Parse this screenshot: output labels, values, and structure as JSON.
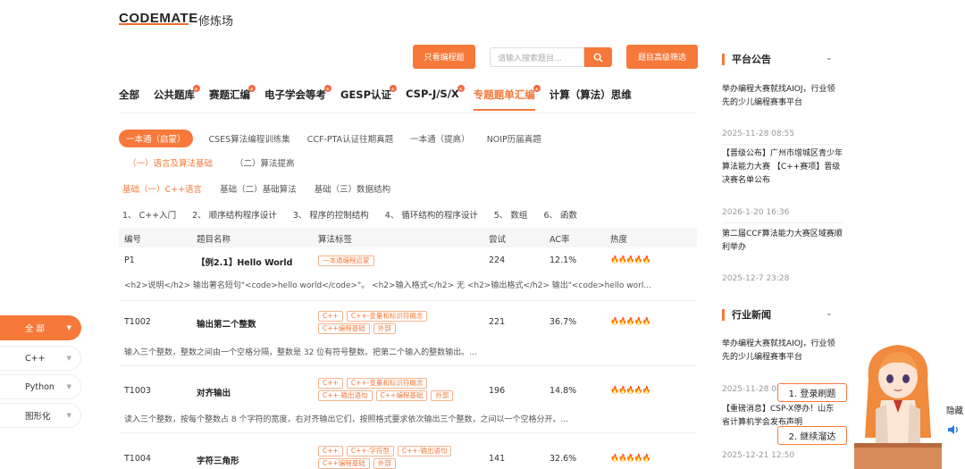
{
  "brand": {
    "logo": "CODEMATE",
    "subtitle": "修炼场"
  },
  "toolbar": {
    "only_programming": "只看编程题",
    "search_placeholder": "请输入搜索题目...",
    "advanced_filter": "题目高级筛选"
  },
  "main_tabs": [
    {
      "label": "全部",
      "badge": false
    },
    {
      "label": "公共题库",
      "badge": true
    },
    {
      "label": "赛题汇编",
      "badge": true
    },
    {
      "label": "电子学会等考",
      "badge": true
    },
    {
      "label": "GESP认证",
      "badge": true
    },
    {
      "label": "CSP-J/S/X",
      "badge": true
    },
    {
      "label": "专题题单汇编",
      "badge": true,
      "active": true
    },
    {
      "label": "计算（算法）思维",
      "badge": false
    }
  ],
  "sub_tabs": [
    "一本通（启蒙）",
    "CSES算法编程训练集",
    "CCF-PTA认证往期真题",
    "一本通（提高）",
    "NOIP历届真题"
  ],
  "sub2": [
    "（一）语言及算法基础",
    "（二）算法提高"
  ],
  "sub3": [
    "基础（一）C++语言",
    "基础（二）基础算法",
    "基础（三）数据结构"
  ],
  "chapters": [
    "1、 C++入门",
    "2、 顺序结构程序设计",
    "3、 程序的控制结构",
    "4、 循环结构的程序设计",
    "5、 数组",
    "6、 函数"
  ],
  "table": {
    "headers": [
      "编号",
      "题目名称",
      "算法标签",
      "尝试",
      "AC率",
      "热度"
    ],
    "rows": [
      {
        "id": "P1",
        "name": "【例2.1】Hello World",
        "tags": [
          "一本通编程启蒙"
        ],
        "tries": "224",
        "ac": "12.1%",
        "heat": "🔥🔥🔥🔥🔥",
        "desc": "<h2>说明</h2> 输出著名短句\"<code>hello world</code>\"。 <h2>输入格式</h2> 无 <h2>输出格式</h2> 输出\"<code>hello worl..."
      },
      {
        "id": "T1002",
        "name": "输出第二个整数",
        "tags": [
          "C++",
          "C++-变量和标识符概念",
          "C++编程基础",
          "外部"
        ],
        "tries": "221",
        "ac": "36.7%",
        "heat": "🔥🔥🔥🔥🔥",
        "desc": "输入三个整数，整数之间由一个空格分隔，整数是 32 位有符号整数。把第二个输入的整数输出。..."
      },
      {
        "id": "T1003",
        "name": "对齐输出",
        "tags": [
          "C++",
          "C++-变量和标识符概念",
          "C++-输出语句",
          "C++编程基础",
          "外部"
        ],
        "tries": "196",
        "ac": "14.8%",
        "heat": "🔥🔥🔥🔥🔥",
        "desc": "读入三个整数，按每个整数占 8 个字符的宽度，右对齐输出它们，按照格式要求依次输出三个整数，之间以一个空格分开。..."
      },
      {
        "id": "T1004",
        "name": "字符三角形",
        "tags": [
          "C++",
          "C++-字符型",
          "C++-输出语句",
          "C++编程基础",
          "外部"
        ],
        "tries": "141",
        "ac": "32.6%",
        "heat": "🔥🔥🔥🔥🔥",
        "desc": ""
      }
    ]
  },
  "lang_menu": [
    {
      "label": "全 部",
      "active": true
    },
    {
      "label": "C++",
      "active": false
    },
    {
      "label": "Python",
      "active": false
    },
    {
      "label": "图形化",
      "active": false
    }
  ],
  "announcements": {
    "title": "平台公告",
    "items": [
      {
        "title": "举办编程大赛就找AIOJ，行业领先的少儿编程赛事平台",
        "date": "2025-11-28 08:55"
      },
      {
        "title": "【晋级公布】广州市增城区青少年算法能力大赛 【C++赛项】晋级决赛名单公布",
        "date": "2026-1-20 16:36"
      },
      {
        "title": "第二届CCF算法能力大赛区域赛顺利举办",
        "date": "2025-12-7 23:28"
      }
    ]
  },
  "industry_news": {
    "title": "行业新闻",
    "items": [
      {
        "title": "举办编程大赛就找AIOJ，行业领先的少儿编程赛事平台",
        "date": "2025-11-28 08:55"
      },
      {
        "title": "【重磅消息】CSP-X停办！山东省计算机学会发布声明",
        "date": "2025-12-21 12:50"
      }
    ]
  },
  "mascot": {
    "login_label": "1. 登录刷题",
    "continue_label": "2. 继续溜达",
    "hide_label": "隐藏"
  },
  "colors": {
    "accent": "#f6793a",
    "text": "#333333"
  }
}
